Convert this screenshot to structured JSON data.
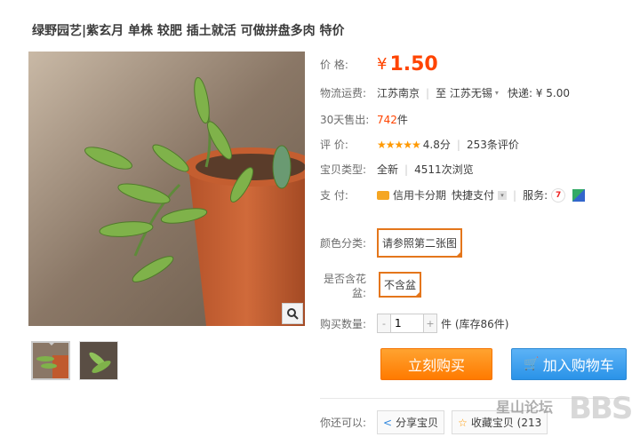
{
  "title": "绿野园艺|紫玄月 单株 较肥 插土就活 可做拼盘多肉 特价",
  "price": {
    "label": "价      格:",
    "currency": "¥",
    "value": "1.50"
  },
  "shipping": {
    "label": "物流运费:",
    "from": "江苏南京",
    "to_prefix": "至",
    "to": "江苏无锡",
    "express": "快递: ¥ 5.00"
  },
  "sales": {
    "label": "30天售出:",
    "count": "742",
    "unit": "件"
  },
  "rating": {
    "label": "评      价:",
    "stars": "★★★★★",
    "score": "4.8分",
    "reviews": "253条评价"
  },
  "item_type": {
    "label": "宝贝类型:",
    "condition": "全新",
    "views": "4511次浏览"
  },
  "payment": {
    "label": "支      付:",
    "credit": "信用卡分期",
    "quick": "快捷支付",
    "service_label": "服务:"
  },
  "color": {
    "label": "颜色分类:",
    "option": "请参照第二张图"
  },
  "pot": {
    "label": "是否含花盆:",
    "option": "不含盆"
  },
  "quantity": {
    "label": "购买数量:",
    "value": "1",
    "stock": "件 (库存86件)"
  },
  "buttons": {
    "buy": "立刻购买",
    "cart": "加入购物车"
  },
  "share": {
    "label": "你还可以:",
    "share_btn": "分享宝贝",
    "collect_btn": "收藏宝贝 (213"
  },
  "watermark": {
    "text": "星山论坛",
    "logo": "BBS"
  },
  "colors": {
    "accent": "#ff4400",
    "buy": "#ff8a00",
    "cart": "#3399ee"
  }
}
